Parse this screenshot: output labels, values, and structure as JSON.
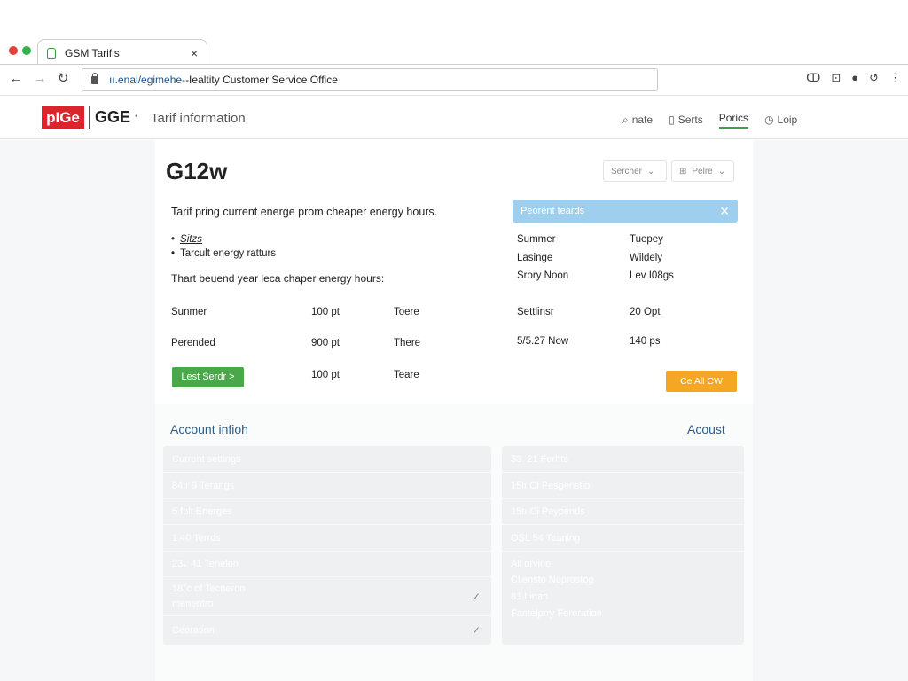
{
  "browser": {
    "tab_title": "GSM Tarifis",
    "tab_close": "×",
    "url_prefix": "ıı.enal/egimehe-",
    "url_rest": "-Iealtity Customer Service Office",
    "back_icon": "←",
    "forward_icon": "→",
    "reload_icon": "↻",
    "extension_icons": [
      "ↀ",
      "⊡",
      "●",
      "↺",
      "⋮"
    ],
    "window_dot_colors": [
      "#e0443e",
      "#2fb34a"
    ]
  },
  "header": {
    "logo": "pIGe",
    "brand": "GGE",
    "separator": "•",
    "title": "Tarif information",
    "nav": [
      {
        "icon": "⌕",
        "label": "nate"
      },
      {
        "icon": "▯",
        "label": "Serts"
      },
      {
        "icon": "",
        "label": "Porics"
      },
      {
        "icon": "◷",
        "label": "Loip"
      }
    ]
  },
  "main": {
    "title": "G12w",
    "dropdowns": [
      {
        "label": "Sercher",
        "icon": "",
        "chevron": "⌄"
      },
      {
        "label": "Pelre",
        "icon": "⊞",
        "chevron": "⌄"
      }
    ],
    "lead": "Tarif pring current energe prom cheaper energy hours.",
    "bullets": [
      {
        "text": "Sitzs",
        "link": true
      },
      {
        "text": "Tarcult energy ratturs",
        "link": false
      }
    ],
    "subheading": "Thart beuend year leca chaper energy hours:",
    "rates": [
      {
        "name": "Sunmer",
        "value": "100 pt",
        "note": "Toere"
      },
      {
        "name": "Perended",
        "value": "900 pt",
        "note": "There"
      },
      {
        "name": "",
        "value": "100 pt",
        "note": "Teare"
      }
    ],
    "green_button": "Lest Serdr  >",
    "alert": {
      "text": "Peorent teards",
      "close": "✕"
    },
    "details": [
      {
        "k": "Summer",
        "v": "Tuepey"
      },
      {
        "k": "Lasinge",
        "v": "Wildely"
      },
      {
        "k": "Srory Noon",
        "v": "Lev I08gs"
      },
      {
        "k": "Settlinsr",
        "v": "20 Opt"
      },
      {
        "k": "5/5.27 Now",
        "v": "140 ps"
      }
    ],
    "orange_button": "Ce All CW"
  },
  "accounts": {
    "left_title": "Account infioh",
    "right_title": "Acoust",
    "left_rows": [
      "Current settings",
      "84ır 9 Terangs",
      "5 folt Energes",
      "1.40 Terrds",
      "23\\. 41 Tenelon"
    ],
    "left_multi": [
      "18°c of Tecneron",
      "menentro"
    ],
    "left_last": "Ceoration",
    "check_icon": "✓",
    "right_rows": [
      "$3. 21 Ferhts",
      "15tı Cl Pesgenstio",
      "15tı Ci Peypends",
      "OSL 54 Teaning"
    ],
    "right_multi": [
      "All orvine",
      "Cliensto Neprostog",
      "81 Linan",
      "Fantelprry Feroration"
    ]
  }
}
